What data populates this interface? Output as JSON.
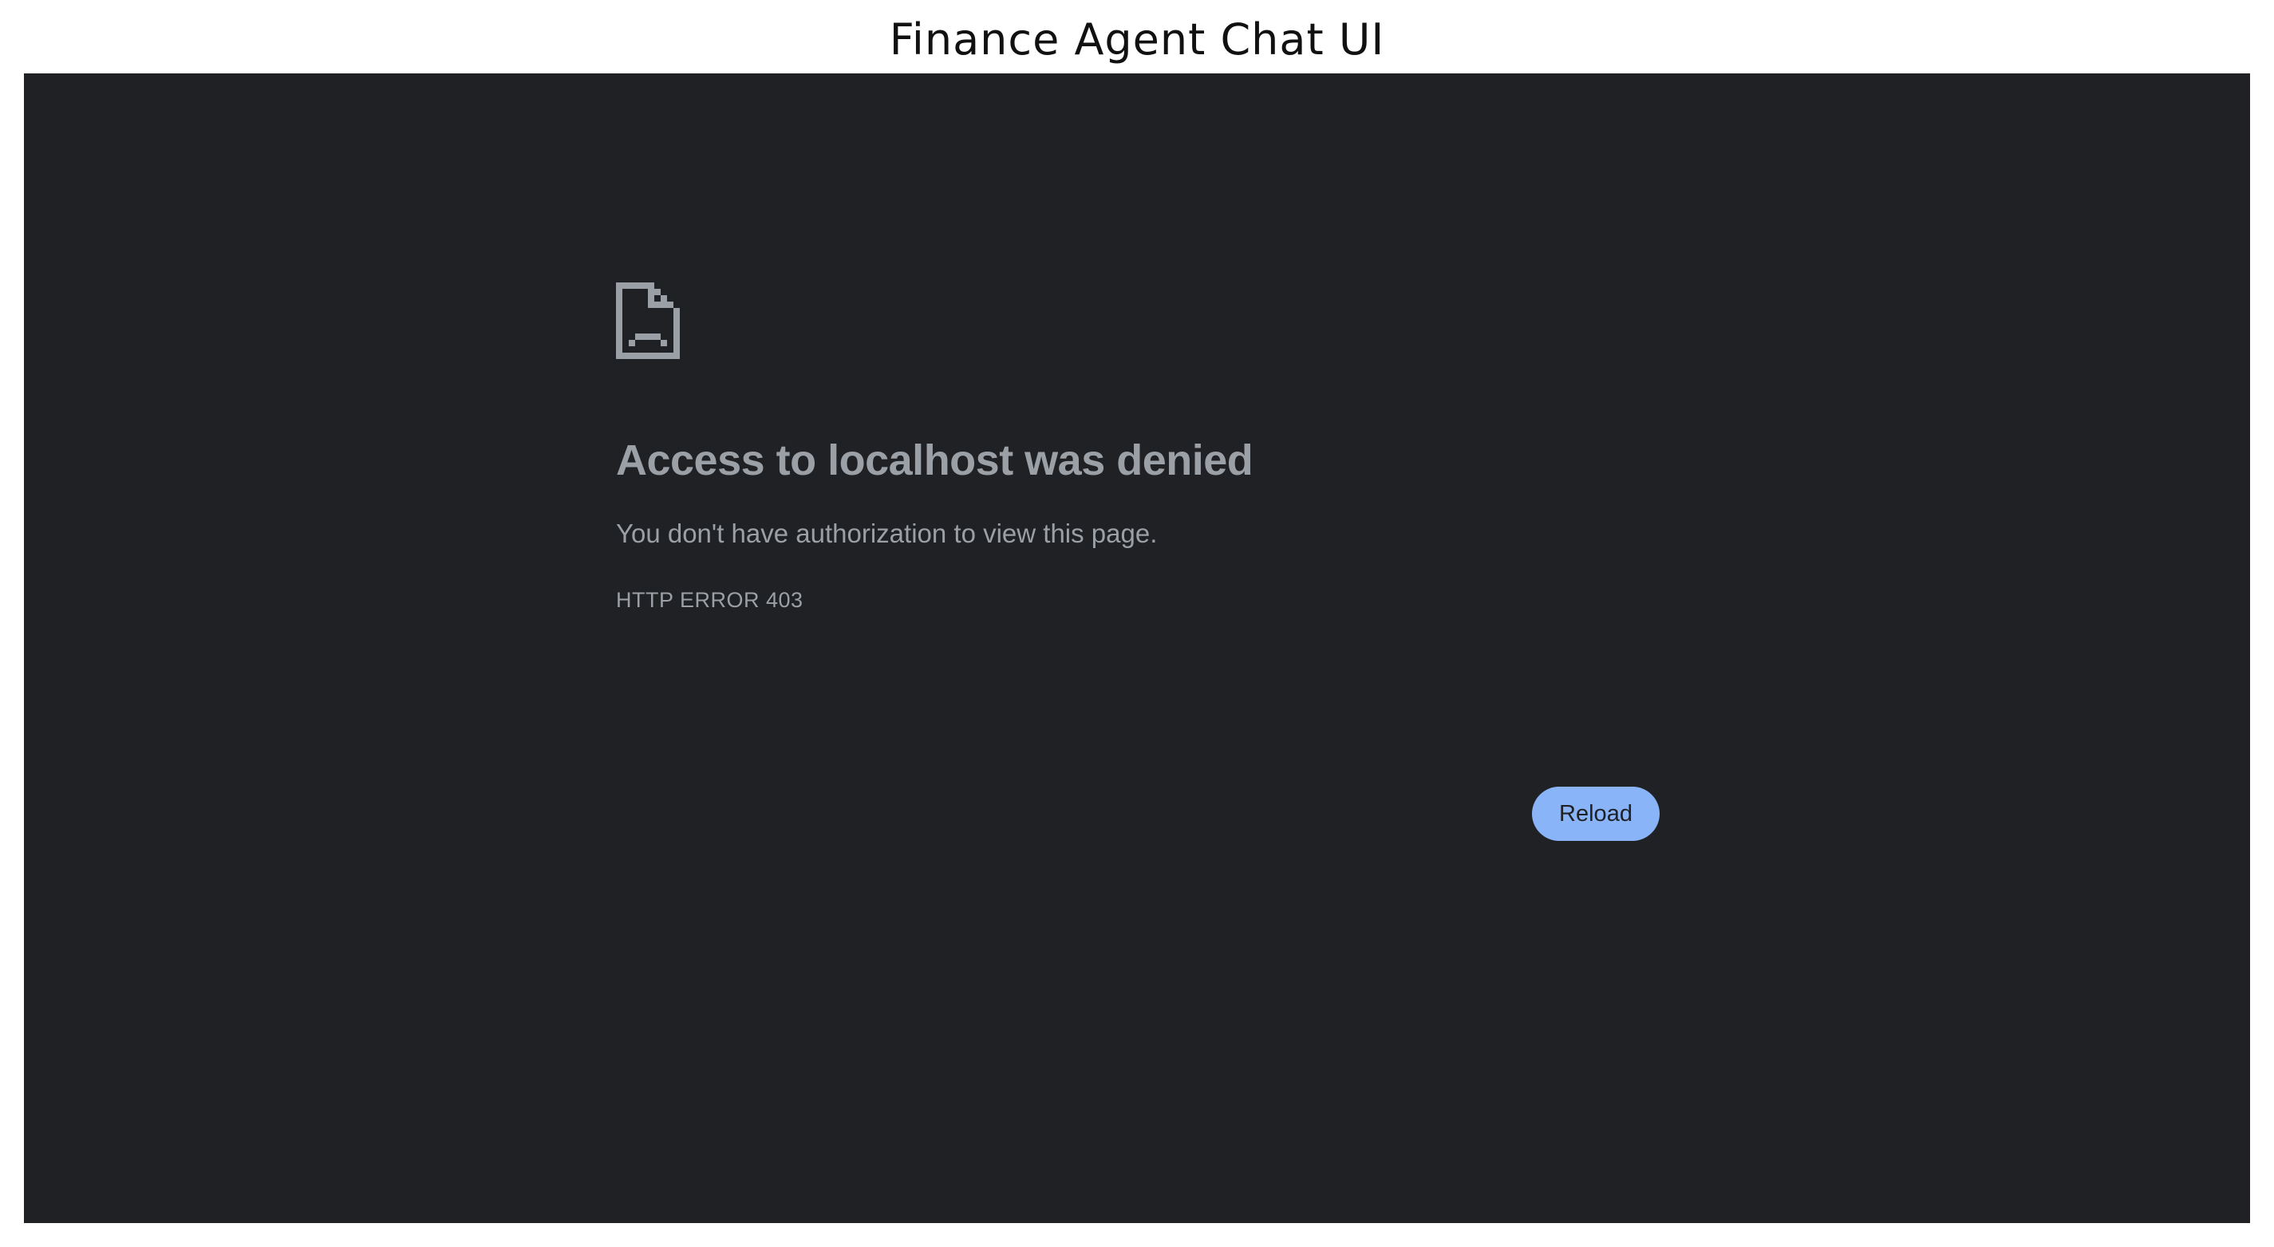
{
  "window": {
    "title": "Finance Agent Chat UI"
  },
  "error_page": {
    "icon": "sad-page-icon",
    "heading": "Access to localhost was denied",
    "message": "You don't have authorization to view this page.",
    "error_code": "HTTP ERROR 403",
    "reload_label": "Reload"
  },
  "colors": {
    "page_background": "#202124",
    "text": "#9aa0a6",
    "button_background": "#8ab4f8",
    "button_text": "#202124"
  }
}
